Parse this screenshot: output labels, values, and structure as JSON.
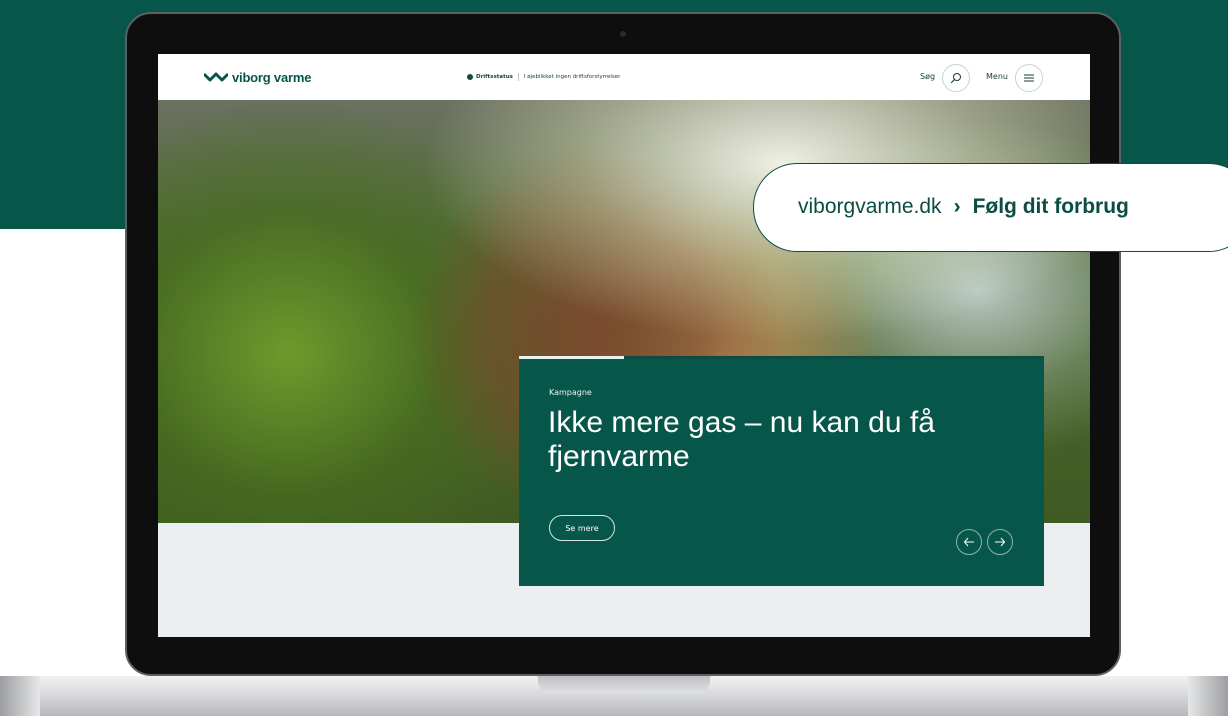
{
  "site": {
    "logo_text": "viborg varme",
    "status_label": "Driftsstatus",
    "status_text": "I øjeblikket ingen driftsforstyrrelser",
    "search_label": "Søg",
    "menu_label": "Menu"
  },
  "campaign": {
    "kicker": "Kampagne",
    "title": "Ikke mere gas – nu kan du få fjernvarme",
    "cta_label": "Se mere",
    "slide_progress": 0.2
  },
  "callout": {
    "domain": "viborgvarme.dk",
    "separator": "›",
    "page": "Følg dit forbrug"
  },
  "colors": {
    "brand_green": "#06574a",
    "panel_green": "#06574a",
    "text_dark": "#163f36"
  },
  "icons": [
    "viborg-varme-logo-icon",
    "status-dot-icon",
    "search-icon",
    "hamburger-menu-icon",
    "arrow-left-icon",
    "arrow-right-icon"
  ]
}
